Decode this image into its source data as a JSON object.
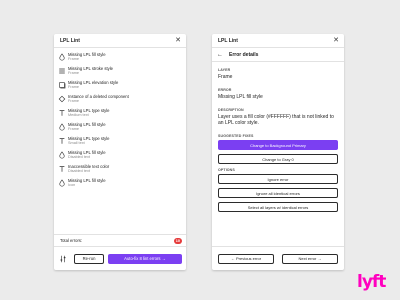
{
  "left_panel": {
    "title": "LPL Lint",
    "items": [
      {
        "title": "Missing LPL fill style",
        "sub": "Frame",
        "icon": "drop-icon"
      },
      {
        "title": "Missing LPL stroke style",
        "sub": "Frame",
        "icon": "stroke-lines-icon"
      },
      {
        "title": "Missing LPL elevation style",
        "sub": "Frame",
        "icon": "square-icon"
      },
      {
        "title": "Instance of a deleted component",
        "sub": "Frame",
        "icon": "diamond-icon"
      },
      {
        "title": "Missing LPL type style",
        "sub": "Medium text",
        "icon": "text-icon"
      },
      {
        "title": "Missing LPL fill style",
        "sub": "Frame",
        "icon": "drop-icon"
      },
      {
        "title": "Missing LPL type style",
        "sub": "Small text",
        "icon": "text-icon"
      },
      {
        "title": "Missing LPL fill style",
        "sub": "Disabled text",
        "icon": "drop-icon"
      },
      {
        "title": "Inaccessible text color",
        "sub": "Disabled text",
        "icon": "text-icon"
      },
      {
        "title": "Missing LPL fill style",
        "sub": "Icon",
        "icon": "drop-icon"
      }
    ],
    "total_label": "Total errors:",
    "total_count": "10",
    "rerun_label": "Re-run",
    "autofix_label": "Auto-fix 8 lint errors →"
  },
  "right_panel": {
    "title": "LPL Lint",
    "header_title": "Error details",
    "layer_label": "LAYER",
    "layer_value": "Frame",
    "error_label": "ERROR",
    "error_value": "Missing LPL fill style",
    "description_label": "DESCRIPTION",
    "description_value": "Layer uses a fill color (#FFFFFF) that is not linked to an LPL color style.",
    "fixes_label": "SUGGESTED FIXES",
    "fix_primary": "Change to Background Primary",
    "fix_secondary": "Change to Gray 0",
    "options_label": "OPTIONS",
    "option_ignore": "Ignore error",
    "option_ignore_all": "Ignore all identical errors",
    "option_select_all": "Select all layers w/ identical errors",
    "prev_label": "← Previous error",
    "next_label": "Next error →"
  },
  "brand": {
    "logo_text": "lyft",
    "logo_color": "#ff00bf",
    "accent": "#7b3ff2",
    "badge_color": "#e53b3b"
  }
}
